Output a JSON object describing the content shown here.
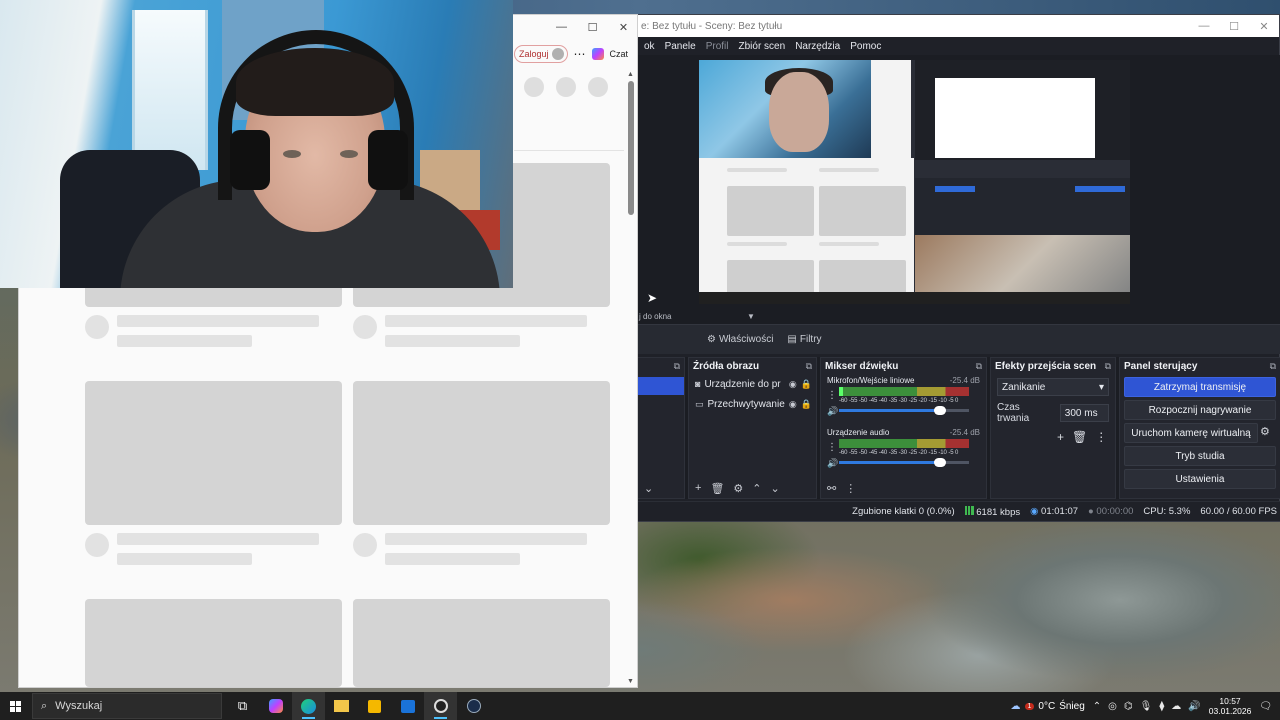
{
  "obs": {
    "title": "e: Bez tytułu - Sceny: Bez tytułu",
    "menu": [
      {
        "label": "ok",
        "dim": false
      },
      {
        "label": "Panele",
        "dim": false
      },
      {
        "label": "Profil",
        "dim": true
      },
      {
        "label": "Zbiór scen",
        "dim": false
      },
      {
        "label": "Narzędzia",
        "dim": false
      },
      {
        "label": "Pomoc",
        "dim": false
      }
    ],
    "source_dropdown": "j do okna",
    "properties_label": "Właściwości",
    "filters_label": "Filtry",
    "sources": {
      "title": "Źródła obrazu",
      "items": [
        {
          "icon": "camera-icon",
          "label": "Urządzenie do pr"
        },
        {
          "icon": "window-icon",
          "label": "Przechwytywanie"
        }
      ]
    },
    "mixer": {
      "title": "Mikser dźwięku",
      "channels": [
        {
          "name": "Mikrofon/Wejście liniowe",
          "db": "-25.4 dB",
          "volume": 0.78
        },
        {
          "name": "Urządzenie audio",
          "db": "-25.4 dB",
          "volume": 0.78
        }
      ],
      "scale": "-60 -55 -50 -45 -40 -35 -30 -25 -20 -15 -10 -5 0"
    },
    "transitions": {
      "title": "Efekty przejścia scen",
      "selected": "Zanikanie",
      "duration_label": "Czas trwania",
      "duration_value": "300 ms"
    },
    "controls": {
      "title": "Panel sterujący",
      "buttons": [
        "Zatrzymaj transmisję",
        "Rozpocznij nagrywanie",
        "Uruchom kamerę wirtualną",
        "Tryb studia",
        "Ustawienia"
      ]
    },
    "status": {
      "dropped": "Zgubione klatki 0 (0.0%)",
      "bitrate": "6181 kbps",
      "stream_time": "01:01:07",
      "rec_time": "00:00:00",
      "cpu": "CPU: 5.3%",
      "fps": "60.00 / 60.00 FPS"
    }
  },
  "browser": {
    "login_label": "Zaloguj",
    "copilot_label": "Czat"
  },
  "taskbar": {
    "search_placeholder": "Wyszukaj",
    "weather_temp": "0°C",
    "weather_text": "Śnieg",
    "weather_badge": "1",
    "time": "10:57",
    "date": "03.01.2026",
    "apps": [
      "task-view-icon",
      "copilot-icon",
      "edge-icon",
      "file-explorer-icon",
      "store-icon",
      "outlook-icon",
      "obs-icon",
      "steam-icon"
    ]
  },
  "colors": {
    "obs_accent": "#2f55d4",
    "obs_bg": "#1f2128",
    "taskbar_bg": "#1f1f1f"
  }
}
